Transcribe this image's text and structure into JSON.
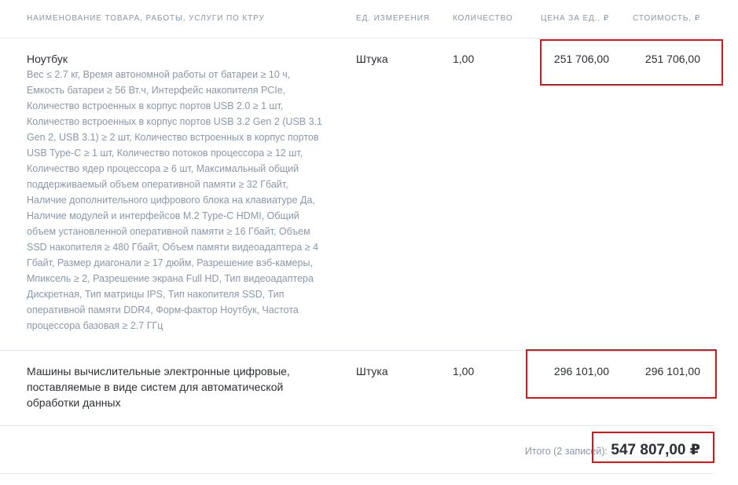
{
  "table": {
    "headers": {
      "name": "НАИМЕНОВАНИЕ ТОВАРА, РАБОТЫ, УСЛУГИ ПО КТРУ",
      "unit": "ЕД. ИЗМЕРЕНИЯ",
      "quantity": "КОЛИЧЕСТВО",
      "price": "ЦЕНА ЗА ЕД., ₽",
      "cost": "СТОИМОСТЬ, ₽"
    },
    "rows": [
      {
        "title": "Ноутбук",
        "description_lines": [
          "Вес ≤ 2.7 кг, Время автономной работы от батареи ≥ 10 ч,",
          "Емкость батареи ≥ 56 Вт.ч, Интерфейс накопителя PCIe,",
          "Количество встроенных в корпус портов USB 2.0 ≥ 1 шт,",
          "Количество встроенных в корпус портов USB 3.2 Gen 2 (USB 3.1",
          "Gen 2, USB 3.1) ≥ 2 шт, Количество встроенных в корпус портов",
          "USB Type-C ≥ 1 шт, Количество потоков процессора ≥ 12 шт,",
          "Количество ядер процессора ≥ 6 шт, Максимальный общий",
          "поддерживаемый объем оперативной памяти ≥ 32 Гбайт,",
          "Наличие дополнительного цифрового блока на клавиатуре Да,",
          "Наличие модулей и интерфейсов M.2 Type-C HDMI, Общий",
          "объем установленной оперативной памяти ≥ 16 Гбайт, Объем",
          "SSD накопителя ≥ 480 Гбайт, Объем памяти видеоадаптера ≥ 4",
          "Гбайт, Размер диагонали ≥ 17 дюйм, Разрешение вэб-камеры,",
          "Мпиксель ≥ 2, Разрешение экрана Full HD, Тип видеоадаптера",
          "Дискретная, Тип матрицы IPS, Тип накопителя SSD, Тип",
          "оперативной памяти DDR4, Форм-фактор Ноутбук, Частота",
          "процессора базовая ≥ 2.7 ГГц"
        ],
        "unit": "Штука",
        "quantity": "1,00",
        "price": "251 706,00",
        "cost": "251 706,00"
      },
      {
        "title_lines": [
          "Машины вычислительные электронные цифровые,",
          "поставляемые в виде систем для автоматической",
          "обработки данных"
        ],
        "unit": "Штука",
        "quantity": "1,00",
        "price": "296 101,00",
        "cost": "296 101,00"
      }
    ],
    "total": {
      "label": "Итого (2 записей):",
      "value": "547 807,00 ₽"
    }
  },
  "colors": {
    "highlight": "#e0131a",
    "text": "#2b2f36",
    "muted": "#8c97a7",
    "divider": "#e3e6ea"
  }
}
